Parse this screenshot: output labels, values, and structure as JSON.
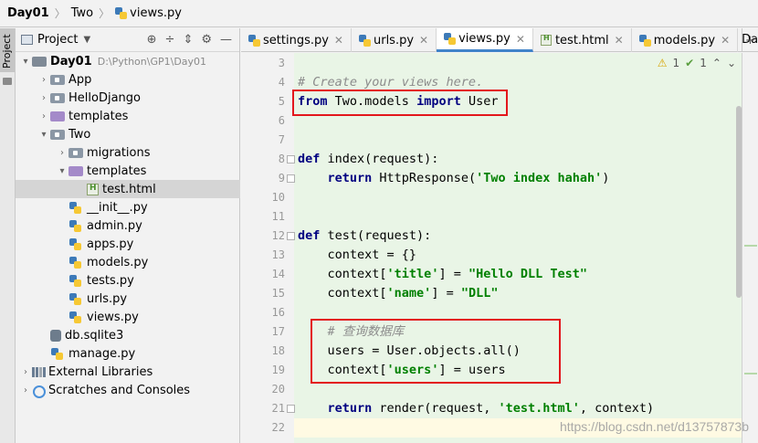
{
  "breadcrumb": {
    "root": "Day01",
    "folder": "Two",
    "file": "views.py"
  },
  "stripe": {
    "project_tab": "Project"
  },
  "project_panel": {
    "title": "Project",
    "tools": [
      "⊕",
      "÷",
      "⇕",
      "⚙",
      "—"
    ],
    "tree": [
      {
        "name": "Day01",
        "path": "D:\\Python\\GP1\\Day01",
        "icon": "folder",
        "arrow": "▾",
        "indent": 0,
        "bold": true
      },
      {
        "name": "App",
        "icon": "folder-pkg",
        "arrow": "›",
        "indent": 1
      },
      {
        "name": "HelloDjango",
        "icon": "folder-pkg",
        "arrow": "›",
        "indent": 1
      },
      {
        "name": "templates",
        "icon": "folder-purple",
        "arrow": "›",
        "indent": 1
      },
      {
        "name": "Two",
        "icon": "folder-pkg",
        "arrow": "▾",
        "indent": 1
      },
      {
        "name": "migrations",
        "icon": "folder-pkg",
        "arrow": "›",
        "indent": 2
      },
      {
        "name": "templates",
        "icon": "folder-purple",
        "arrow": "▾",
        "indent": 2
      },
      {
        "name": "test.html",
        "icon": "html-file",
        "arrow": "",
        "indent": 3,
        "selected": true
      },
      {
        "name": "__init__.py",
        "icon": "py-file",
        "arrow": "",
        "indent": 2
      },
      {
        "name": "admin.py",
        "icon": "py-file",
        "arrow": "",
        "indent": 2
      },
      {
        "name": "apps.py",
        "icon": "py-file",
        "arrow": "",
        "indent": 2
      },
      {
        "name": "models.py",
        "icon": "py-file",
        "arrow": "",
        "indent": 2
      },
      {
        "name": "tests.py",
        "icon": "py-file",
        "arrow": "",
        "indent": 2
      },
      {
        "name": "urls.py",
        "icon": "py-file",
        "arrow": "",
        "indent": 2
      },
      {
        "name": "views.py",
        "icon": "py-file",
        "arrow": "",
        "indent": 2
      },
      {
        "name": "db.sqlite3",
        "icon": "db-file",
        "arrow": "",
        "indent": 1
      },
      {
        "name": "manage.py",
        "icon": "py-file",
        "arrow": "",
        "indent": 1
      },
      {
        "name": "External Libraries",
        "icon": "libraries",
        "arrow": "›",
        "indent": 0
      },
      {
        "name": "Scratches and Consoles",
        "icon": "scratches",
        "arrow": "›",
        "indent": 0
      }
    ]
  },
  "editor_tabs": [
    {
      "label": "settings.py",
      "icon": "py-file",
      "active": false
    },
    {
      "label": "urls.py",
      "icon": "py-file",
      "active": false
    },
    {
      "label": "views.py",
      "icon": "py-file",
      "active": true
    },
    {
      "label": "test.html",
      "icon": "html-file",
      "active": false
    },
    {
      "label": "models.py",
      "icon": "py-file",
      "active": false
    }
  ],
  "editor_tabs_overflow": "Da",
  "inspection": {
    "warnings": "1",
    "ok": "1"
  },
  "code": {
    "lines": [
      {
        "n": "3",
        "parts": []
      },
      {
        "n": "4",
        "parts": [
          {
            "t": "# Create your views here.",
            "c": "cm"
          }
        ]
      },
      {
        "n": "5",
        "parts": [
          {
            "t": "from",
            "c": "kw"
          },
          {
            "t": " Two.models ",
            "c": ""
          },
          {
            "t": "import",
            "c": "kw"
          },
          {
            "t": " User",
            "c": ""
          }
        ]
      },
      {
        "n": "6",
        "parts": []
      },
      {
        "n": "7",
        "parts": []
      },
      {
        "n": "8",
        "parts": [
          {
            "t": "def",
            "c": "kw"
          },
          {
            "t": " index(request):",
            "c": ""
          }
        ]
      },
      {
        "n": "9",
        "parts": [
          {
            "t": "    ",
            "c": ""
          },
          {
            "t": "return",
            "c": "kw"
          },
          {
            "t": " HttpResponse(",
            "c": ""
          },
          {
            "t": "'Two index hahah'",
            "c": "str"
          },
          {
            "t": ")",
            "c": ""
          }
        ]
      },
      {
        "n": "10",
        "parts": []
      },
      {
        "n": "11",
        "parts": []
      },
      {
        "n": "12",
        "parts": [
          {
            "t": "def",
            "c": "kw"
          },
          {
            "t": " test(request):",
            "c": ""
          }
        ]
      },
      {
        "n": "13",
        "parts": [
          {
            "t": "    context = {}",
            "c": ""
          }
        ]
      },
      {
        "n": "14",
        "parts": [
          {
            "t": "    context[",
            "c": ""
          },
          {
            "t": "'title'",
            "c": "str"
          },
          {
            "t": "] = ",
            "c": ""
          },
          {
            "t": "\"Hello DLL Test\"",
            "c": "str"
          }
        ]
      },
      {
        "n": "15",
        "parts": [
          {
            "t": "    context[",
            "c": ""
          },
          {
            "t": "'name'",
            "c": "str"
          },
          {
            "t": "] = ",
            "c": ""
          },
          {
            "t": "\"DLL\"",
            "c": "str"
          }
        ]
      },
      {
        "n": "16",
        "parts": []
      },
      {
        "n": "17",
        "parts": [
          {
            "t": "    # 查询数据库",
            "c": "cm"
          }
        ]
      },
      {
        "n": "18",
        "parts": [
          {
            "t": "    users = User.objects.all()",
            "c": ""
          }
        ]
      },
      {
        "n": "19",
        "parts": [
          {
            "t": "    context[",
            "c": ""
          },
          {
            "t": "'users'",
            "c": "str"
          },
          {
            "t": "] = users",
            "c": ""
          }
        ]
      },
      {
        "n": "20",
        "parts": []
      },
      {
        "n": "21",
        "parts": [
          {
            "t": "    ",
            "c": ""
          },
          {
            "t": "return",
            "c": "kw"
          },
          {
            "t": " render(request, ",
            "c": ""
          },
          {
            "t": "'test.html'",
            "c": "str"
          },
          {
            "t": ", context)",
            "c": ""
          }
        ]
      },
      {
        "n": "22",
        "parts": []
      }
    ]
  },
  "watermark": "https://blog.csdn.net/d13757873b",
  "colors": {
    "accent": "#4083c9",
    "highlight_box": "#e3171c",
    "editor_bg": "#e9f5e6",
    "keyword": "#000080",
    "string": "#008000"
  }
}
